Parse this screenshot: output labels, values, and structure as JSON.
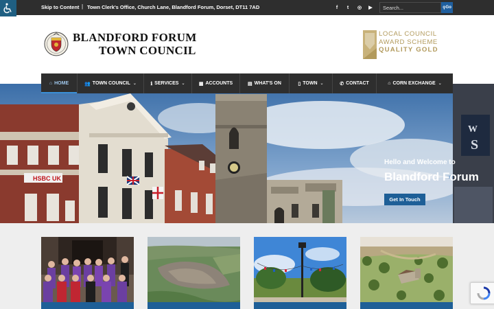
{
  "topbar": {
    "skip_link": "Skip to Content",
    "separator": "|",
    "address": "Town Clerk's Office, Church Lane, Blandford Forum, Dorset, DT11 7AD",
    "social": [
      {
        "name": "facebook-icon",
        "glyph": "f"
      },
      {
        "name": "twitter-icon",
        "glyph": "t"
      },
      {
        "name": "instagram-icon",
        "glyph": "◎"
      },
      {
        "name": "youtube-icon",
        "glyph": "▶"
      }
    ],
    "search_placeholder": "Search...",
    "search_button": "Go"
  },
  "header": {
    "title_line1": "BLANDFORD FORUM",
    "title_line2": "TOWN COUNCIL",
    "award_line1": "LOCAL COUNCIL",
    "award_line2": "AWARD SCHEME",
    "award_line3": "QUALITY GOLD"
  },
  "nav": {
    "items": [
      {
        "label": "HOME",
        "icon": "⌂",
        "caret": ""
      },
      {
        "label": "TOWN COUNCIL",
        "icon": "👥",
        "caret": "⌄"
      },
      {
        "label": "SERVICES",
        "icon": "ℹ",
        "caret": "⌄"
      },
      {
        "label": "ACCOUNTS",
        "icon": "▦",
        "caret": ""
      },
      {
        "label": "WHAT'S ON",
        "icon": "▤",
        "caret": ""
      },
      {
        "label": "TOWN",
        "icon": "▯",
        "caret": "⌄"
      },
      {
        "label": "CONTACT",
        "icon": "✆",
        "caret": ""
      },
      {
        "label": "CORN EXCHANGE",
        "icon": "⌂",
        "caret": "⌄"
      }
    ]
  },
  "hero": {
    "welcome": "Hello and Welcome to",
    "title": "Blandford Forum",
    "button": "Get In Touch",
    "sign_text": "HSBC UK"
  },
  "colors": {
    "topbar": "#2e2e2e",
    "accent_blue": "#1e5f97",
    "award_gold": "#b29a5c"
  }
}
